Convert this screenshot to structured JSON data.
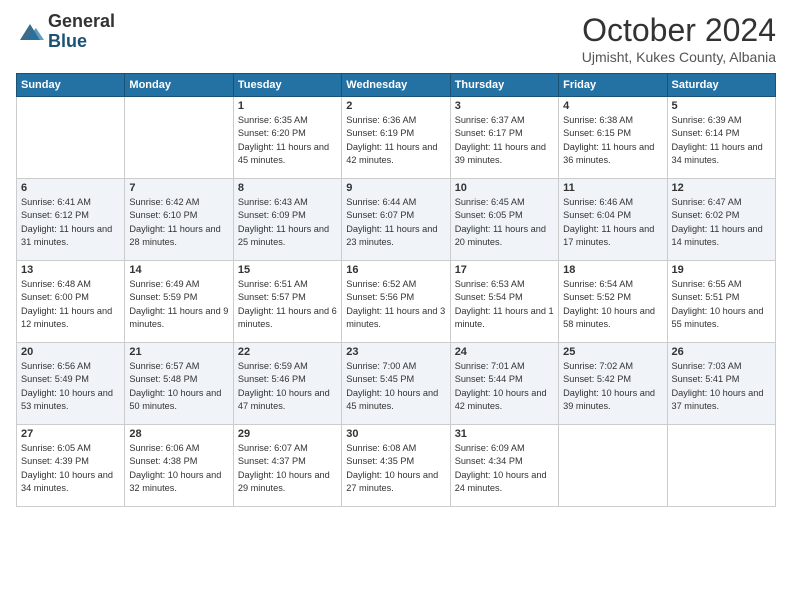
{
  "header": {
    "logo": {
      "general": "General",
      "blue": "Blue"
    },
    "title": "October 2024",
    "subtitle": "Ujmisht, Kukes County, Albania"
  },
  "weekdays": [
    "Sunday",
    "Monday",
    "Tuesday",
    "Wednesday",
    "Thursday",
    "Friday",
    "Saturday"
  ],
  "weeks": [
    [
      {
        "day": "",
        "sunrise": "",
        "sunset": "",
        "daylight": ""
      },
      {
        "day": "",
        "sunrise": "",
        "sunset": "",
        "daylight": ""
      },
      {
        "day": "1",
        "sunrise": "Sunrise: 6:35 AM",
        "sunset": "Sunset: 6:20 PM",
        "daylight": "Daylight: 11 hours and 45 minutes."
      },
      {
        "day": "2",
        "sunrise": "Sunrise: 6:36 AM",
        "sunset": "Sunset: 6:19 PM",
        "daylight": "Daylight: 11 hours and 42 minutes."
      },
      {
        "day": "3",
        "sunrise": "Sunrise: 6:37 AM",
        "sunset": "Sunset: 6:17 PM",
        "daylight": "Daylight: 11 hours and 39 minutes."
      },
      {
        "day": "4",
        "sunrise": "Sunrise: 6:38 AM",
        "sunset": "Sunset: 6:15 PM",
        "daylight": "Daylight: 11 hours and 36 minutes."
      },
      {
        "day": "5",
        "sunrise": "Sunrise: 6:39 AM",
        "sunset": "Sunset: 6:14 PM",
        "daylight": "Daylight: 11 hours and 34 minutes."
      }
    ],
    [
      {
        "day": "6",
        "sunrise": "Sunrise: 6:41 AM",
        "sunset": "Sunset: 6:12 PM",
        "daylight": "Daylight: 11 hours and 31 minutes."
      },
      {
        "day": "7",
        "sunrise": "Sunrise: 6:42 AM",
        "sunset": "Sunset: 6:10 PM",
        "daylight": "Daylight: 11 hours and 28 minutes."
      },
      {
        "day": "8",
        "sunrise": "Sunrise: 6:43 AM",
        "sunset": "Sunset: 6:09 PM",
        "daylight": "Daylight: 11 hours and 25 minutes."
      },
      {
        "day": "9",
        "sunrise": "Sunrise: 6:44 AM",
        "sunset": "Sunset: 6:07 PM",
        "daylight": "Daylight: 11 hours and 23 minutes."
      },
      {
        "day": "10",
        "sunrise": "Sunrise: 6:45 AM",
        "sunset": "Sunset: 6:05 PM",
        "daylight": "Daylight: 11 hours and 20 minutes."
      },
      {
        "day": "11",
        "sunrise": "Sunrise: 6:46 AM",
        "sunset": "Sunset: 6:04 PM",
        "daylight": "Daylight: 11 hours and 17 minutes."
      },
      {
        "day": "12",
        "sunrise": "Sunrise: 6:47 AM",
        "sunset": "Sunset: 6:02 PM",
        "daylight": "Daylight: 11 hours and 14 minutes."
      }
    ],
    [
      {
        "day": "13",
        "sunrise": "Sunrise: 6:48 AM",
        "sunset": "Sunset: 6:00 PM",
        "daylight": "Daylight: 11 hours and 12 minutes."
      },
      {
        "day": "14",
        "sunrise": "Sunrise: 6:49 AM",
        "sunset": "Sunset: 5:59 PM",
        "daylight": "Daylight: 11 hours and 9 minutes."
      },
      {
        "day": "15",
        "sunrise": "Sunrise: 6:51 AM",
        "sunset": "Sunset: 5:57 PM",
        "daylight": "Daylight: 11 hours and 6 minutes."
      },
      {
        "day": "16",
        "sunrise": "Sunrise: 6:52 AM",
        "sunset": "Sunset: 5:56 PM",
        "daylight": "Daylight: 11 hours and 3 minutes."
      },
      {
        "day": "17",
        "sunrise": "Sunrise: 6:53 AM",
        "sunset": "Sunset: 5:54 PM",
        "daylight": "Daylight: 11 hours and 1 minute."
      },
      {
        "day": "18",
        "sunrise": "Sunrise: 6:54 AM",
        "sunset": "Sunset: 5:52 PM",
        "daylight": "Daylight: 10 hours and 58 minutes."
      },
      {
        "day": "19",
        "sunrise": "Sunrise: 6:55 AM",
        "sunset": "Sunset: 5:51 PM",
        "daylight": "Daylight: 10 hours and 55 minutes."
      }
    ],
    [
      {
        "day": "20",
        "sunrise": "Sunrise: 6:56 AM",
        "sunset": "Sunset: 5:49 PM",
        "daylight": "Daylight: 10 hours and 53 minutes."
      },
      {
        "day": "21",
        "sunrise": "Sunrise: 6:57 AM",
        "sunset": "Sunset: 5:48 PM",
        "daylight": "Daylight: 10 hours and 50 minutes."
      },
      {
        "day": "22",
        "sunrise": "Sunrise: 6:59 AM",
        "sunset": "Sunset: 5:46 PM",
        "daylight": "Daylight: 10 hours and 47 minutes."
      },
      {
        "day": "23",
        "sunrise": "Sunrise: 7:00 AM",
        "sunset": "Sunset: 5:45 PM",
        "daylight": "Daylight: 10 hours and 45 minutes."
      },
      {
        "day": "24",
        "sunrise": "Sunrise: 7:01 AM",
        "sunset": "Sunset: 5:44 PM",
        "daylight": "Daylight: 10 hours and 42 minutes."
      },
      {
        "day": "25",
        "sunrise": "Sunrise: 7:02 AM",
        "sunset": "Sunset: 5:42 PM",
        "daylight": "Daylight: 10 hours and 39 minutes."
      },
      {
        "day": "26",
        "sunrise": "Sunrise: 7:03 AM",
        "sunset": "Sunset: 5:41 PM",
        "daylight": "Daylight: 10 hours and 37 minutes."
      }
    ],
    [
      {
        "day": "27",
        "sunrise": "Sunrise: 6:05 AM",
        "sunset": "Sunset: 4:39 PM",
        "daylight": "Daylight: 10 hours and 34 minutes."
      },
      {
        "day": "28",
        "sunrise": "Sunrise: 6:06 AM",
        "sunset": "Sunset: 4:38 PM",
        "daylight": "Daylight: 10 hours and 32 minutes."
      },
      {
        "day": "29",
        "sunrise": "Sunrise: 6:07 AM",
        "sunset": "Sunset: 4:37 PM",
        "daylight": "Daylight: 10 hours and 29 minutes."
      },
      {
        "day": "30",
        "sunrise": "Sunrise: 6:08 AM",
        "sunset": "Sunset: 4:35 PM",
        "daylight": "Daylight: 10 hours and 27 minutes."
      },
      {
        "day": "31",
        "sunrise": "Sunrise: 6:09 AM",
        "sunset": "Sunset: 4:34 PM",
        "daylight": "Daylight: 10 hours and 24 minutes."
      },
      {
        "day": "",
        "sunrise": "",
        "sunset": "",
        "daylight": ""
      },
      {
        "day": "",
        "sunrise": "",
        "sunset": "",
        "daylight": ""
      }
    ]
  ]
}
